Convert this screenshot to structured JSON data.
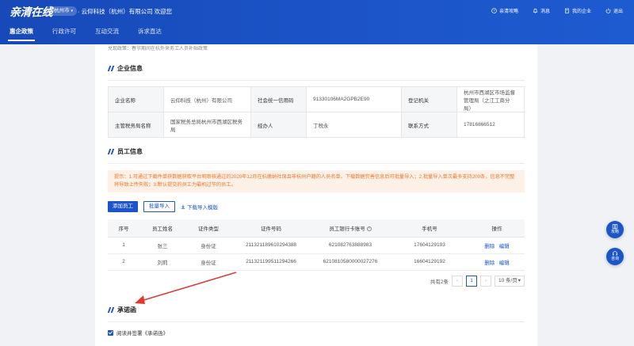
{
  "header": {
    "logo": "亲清在线",
    "city": "杭州市",
    "welcome": "云仰科技（杭州）有限公司 欢迎您",
    "actions": [
      "亲清攻略",
      "消息",
      "我的企业",
      "退出"
    ]
  },
  "nav": {
    "tabs": [
      "惠企政策",
      "行政许可",
      "互动交流",
      "诉求直达"
    ]
  },
  "breadcrumb": "兑现政策：春节期间在杭外来务工人员补贴政策",
  "company_section": {
    "title": "企业信息",
    "rows": [
      {
        "l1": "企业名称",
        "v1": "云仰科技（杭州）有限公司",
        "l2": "社会统一信用码",
        "v2": "91330106MA2GPB2E90",
        "l3": "登记机关",
        "v3": "杭州市西湖区市场监督管理局（之江工商分局）"
      },
      {
        "l1": "主管税务局名称",
        "v1": "国家税务总局杭州市西湖区税务局",
        "l2": "经办人",
        "v2": "丁税永",
        "l3": "联系方式",
        "v3": "17816866512"
      }
    ]
  },
  "staff_section": {
    "title": "员工信息",
    "notice_line1": "提示：1.可通过下载件单获数据获取平台明审核通过的2020年12月在杭缴纳社保且非杭州户籍的人员名单，下载数据完善信息后可批量导入；2.批量导入单次最多支持200条，信息不完整",
    "notice_line2": "将导致上传失败；3.默认提交的员工为最机过节的员工。",
    "add_button": "添加员工",
    "import_button": "批量导入",
    "download_link": "下载导入模版",
    "columns": [
      "序号",
      "员工姓名",
      "证件类型",
      "证件号码",
      "员工银行卡账号",
      "手机号",
      "操作"
    ],
    "rows": [
      {
        "no": "1",
        "name": "张三",
        "id_type": "身份证",
        "id_no": "211321189610294388",
        "card": "621082763888983",
        "phone": "17604129193",
        "op1": "删除",
        "op2": "编辑"
      },
      {
        "no": "2",
        "name": "刘莉",
        "id_type": "身份证",
        "id_no": "211321199511294266",
        "card": "6210810580000027276",
        "phone": "16604129192",
        "op1": "删除",
        "op2": "编辑"
      }
    ],
    "pager": {
      "total": "共有2条",
      "current": "1",
      "page_size": "10 条/页"
    }
  },
  "promise_section": {
    "title": "承诺函",
    "agree_text": "阅读并签署《承诺函》"
  },
  "float": {
    "guide": "攻略",
    "service": "咨询"
  },
  "colors": {
    "brand": "#1c55c9",
    "notice_bg": "#fdf0e6",
    "notice_text": "#e8772e",
    "annotation": "#e03a2f"
  }
}
